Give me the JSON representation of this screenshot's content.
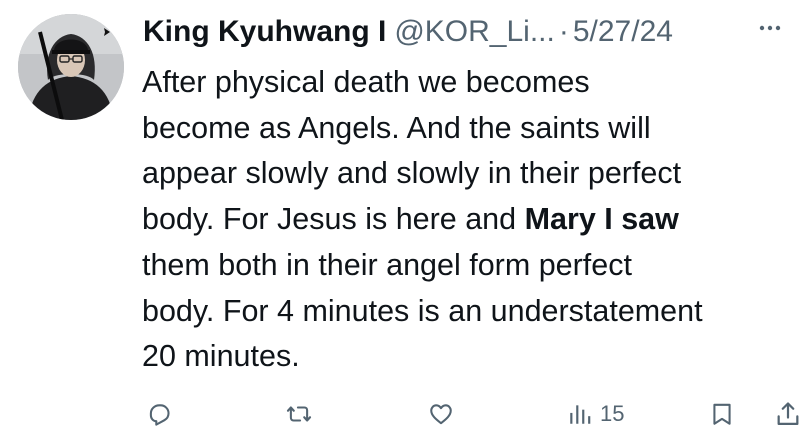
{
  "tweet": {
    "author": {
      "display_name": "King Kyuhwang I",
      "handle": "@KOR_Li...",
      "avatar_icon": "avatar-photo"
    },
    "separator": "·",
    "date": "5/27/24",
    "more_icon": "more-horizontal-icon",
    "text": {
      "part1": "After physical death we becomes\nbecome as Angels. And the saints will\nappear slowly and slowly in their perfect\nbody. For Jesus is here and ",
      "bold": "Mary I saw",
      "part2": "\nthem both in their angel form perfect\nbody. For 4 minutes is an understatement\n20 minutes."
    },
    "actions": {
      "reply_icon": "reply-icon",
      "retweet_icon": "retweet-icon",
      "like_icon": "like-heart-icon",
      "views_icon": "views-bar-chart-icon",
      "views_count": "15",
      "bookmark_icon": "bookmark-icon",
      "share_icon": "share-icon"
    }
  },
  "colors": {
    "text_primary": "#0f1419",
    "text_secondary": "#536471",
    "background": "#ffffff"
  }
}
